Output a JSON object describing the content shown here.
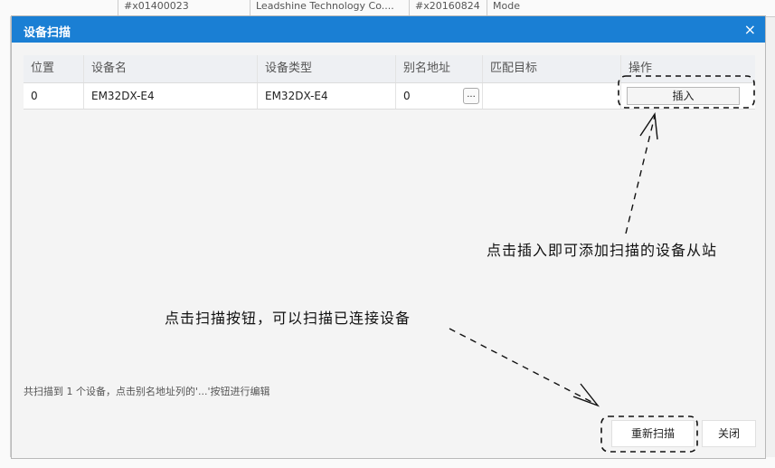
{
  "background": {
    "cells": [
      "#x01400023",
      "Leadshine Technology Co....",
      "#x20160824",
      "Mode"
    ]
  },
  "dialog": {
    "title": "设备扫描",
    "close_glyph": "×",
    "columns": [
      "位置",
      "设备名",
      "设备类型",
      "别名地址",
      "匹配目标",
      "操作"
    ],
    "rows": [
      {
        "position": "0",
        "device_name": "EM32DX-E4",
        "device_type": "EM32DX-E4",
        "alias_address": "0",
        "match_target": "",
        "action_label": "插入",
        "ellipsis": "..."
      }
    ],
    "hint": "共扫描到 1 个设备，点击别名地址列的'...'按钮进行编辑",
    "rescan_label": "重新扫描",
    "close_label": "关闭"
  },
  "annotations": {
    "insert_note": "点击插入即可添加扫描的设备从站",
    "scan_note": "点击扫描按钮，可以扫描已连接设备"
  },
  "colors": {
    "titlebar": "#1a7fd4",
    "annotation": "#111111"
  }
}
